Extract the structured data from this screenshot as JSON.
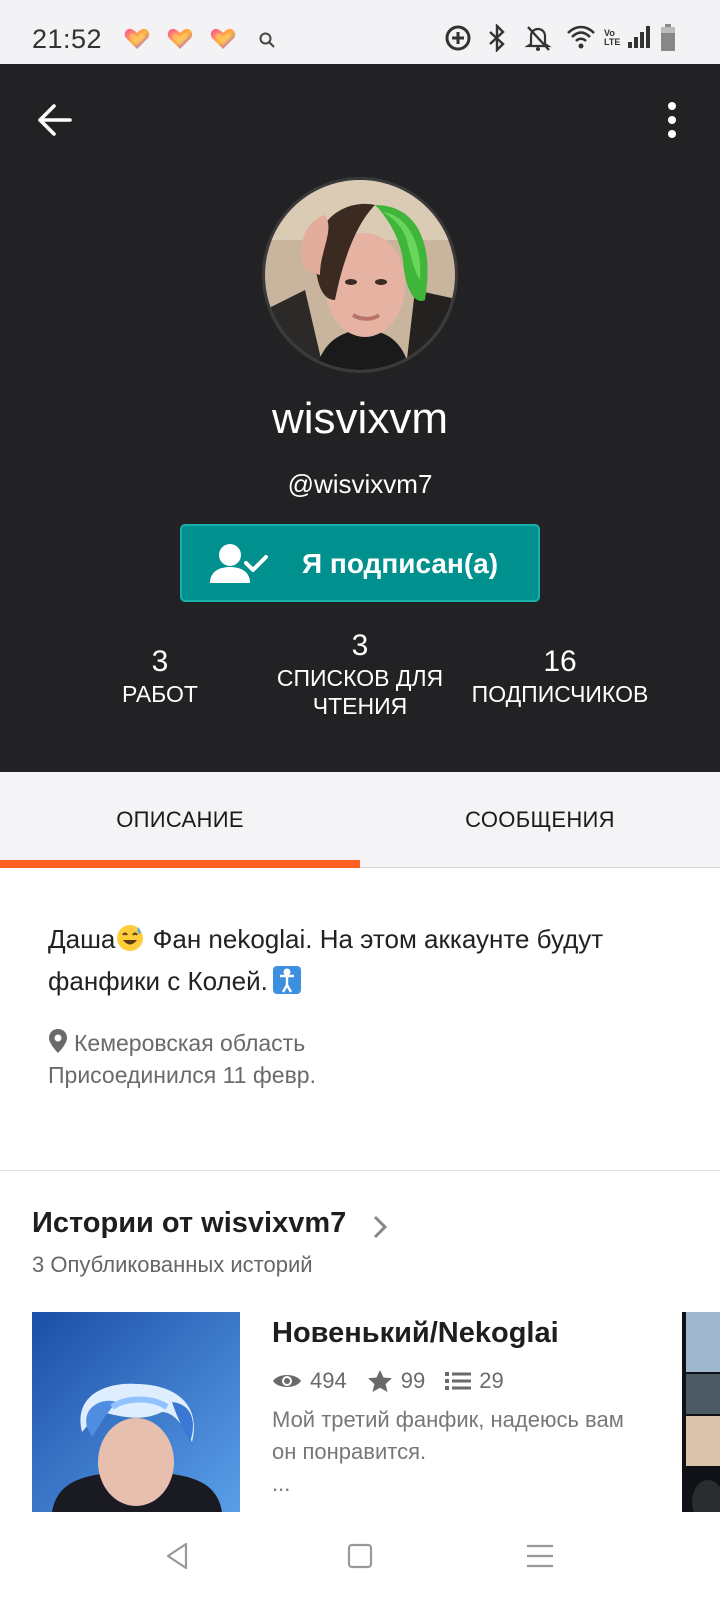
{
  "status_bar": {
    "time": "21:52",
    "icons": [
      "heart-app-icon",
      "heart-app-icon",
      "heart-app-icon",
      "search-icon",
      "data-saver-icon",
      "bluetooth-icon",
      "mute-icon",
      "wifi-icon",
      "volte-icon",
      "signal-icon",
      "battery-icon"
    ],
    "volte_label": "Vo LTE"
  },
  "header": {
    "display_name": "wisvixvm",
    "handle": "@wisvixvm7",
    "follow_label": "Я подписан(а)",
    "stats": [
      {
        "value": "3",
        "label_lines": [
          "РАБОТ"
        ]
      },
      {
        "value": "3",
        "label_lines": [
          "СПИСКОВ ДЛЯ",
          "ЧТЕНИЯ"
        ]
      },
      {
        "value": "16",
        "label_lines": [
          "ПОДПИСЧИКОВ"
        ]
      }
    ]
  },
  "tabs": [
    {
      "label": "ОПИСАНИЕ",
      "active": true
    },
    {
      "label": "СООБЩЕНИЯ",
      "active": false
    }
  ],
  "about": {
    "bio_part1": "Даша",
    "bio_part2": " Фан nekoglai. На этом аккаунте будут фанфики с Колей.",
    "location": "Кемеровская область",
    "joined": "Присоединился 11 февр."
  },
  "stories": {
    "title": "Истории от wisvixvm7",
    "count": "3 Опубликованных историй",
    "items": [
      {
        "title": "Новенький/Nekoglai",
        "reads": "494",
        "votes": "99",
        "parts": "29",
        "description": "Мой третий фанфик, надеюсь вам он понравится.",
        "ellipsis": "..."
      }
    ]
  },
  "colors": {
    "header_bg": "#222124",
    "follow_button": "#00918f",
    "tab_indicator": "#ff6122"
  }
}
